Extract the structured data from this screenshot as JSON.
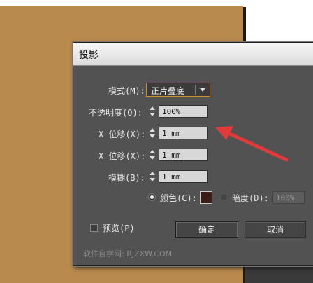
{
  "dialog": {
    "title": "投影",
    "mode_label": "模式(M):",
    "mode_value": "正片叠底",
    "opacity_label": "不透明度(O):",
    "opacity_value": "100%",
    "x_offset_label": "X 位移(X):",
    "x_offset_value": "1 mm",
    "y_offset_label": "X 位移(X):",
    "y_offset_value": "1 mm",
    "blur_label": "模糊(B):",
    "blur_value": "1 mm",
    "color_label": "颜色(C):",
    "darkness_label": "暗度(D):",
    "darkness_value": "100%",
    "preview_label": "预览(P)",
    "ok_label": "确定",
    "cancel_label": "取消",
    "swatch_color": "#3a1d14"
  },
  "watermark": "软件自学网: RJZXW.COM",
  "colors": {
    "artboard": "#b98a4e",
    "dialog_bg": "#525252",
    "accent_border": "#d78a2b",
    "annotation_arrow": "#e03a3a"
  },
  "icons": {
    "spinner": "spin-up-down-icon",
    "dropdown": "chevron-down-icon",
    "annotation": "red-arrow-icon"
  }
}
